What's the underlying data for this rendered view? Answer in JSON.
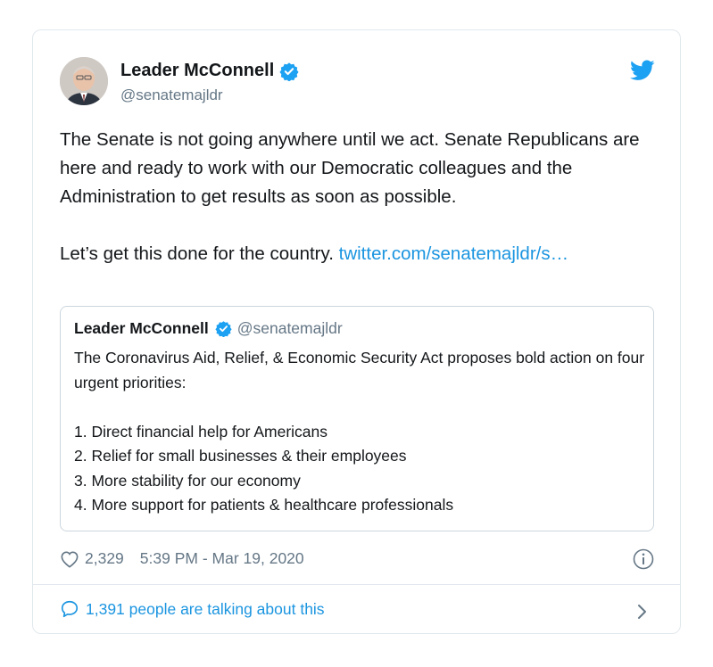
{
  "tweet": {
    "display_name": "Leader McConnell",
    "handle": "@senatemajldr",
    "text_main": "The Senate is not going anywhere until we act. Senate Republicans are here and ready to work with our Democratic colleagues and the Administration to get results as soon as possible.\n\nLet’s get this done for the country. ",
    "link_text": "twitter.com/senatemajldr/s…",
    "likes": "2,329",
    "timestamp": "5:39 PM - Mar 19, 2020",
    "talking": "1,391 people are talking about this"
  },
  "quote": {
    "display_name": "Leader McConnell",
    "handle": "@senatemajldr",
    "intro": "The Coronavirus Aid, Relief, & Economic Security Act proposes bold action on four urgent priorities:",
    "items": [
      "1. Direct financial help for Americans",
      "2. Relief for small businesses & their employees",
      "3. More stability for our economy",
      "4. More support for patients & healthcare professionals"
    ]
  },
  "icons": {
    "avatar": "profile-photo",
    "verified": "verified-badge-icon",
    "brand": "twitter-bird-icon",
    "like": "heart-icon",
    "info": "info-icon",
    "reply": "speech-bubble-icon",
    "more": "chevron-right-icon"
  },
  "colors": {
    "link": "#1b95e0",
    "verified": "#1da1f2",
    "secondary_text": "#657786",
    "border": "#e1e8ed"
  }
}
